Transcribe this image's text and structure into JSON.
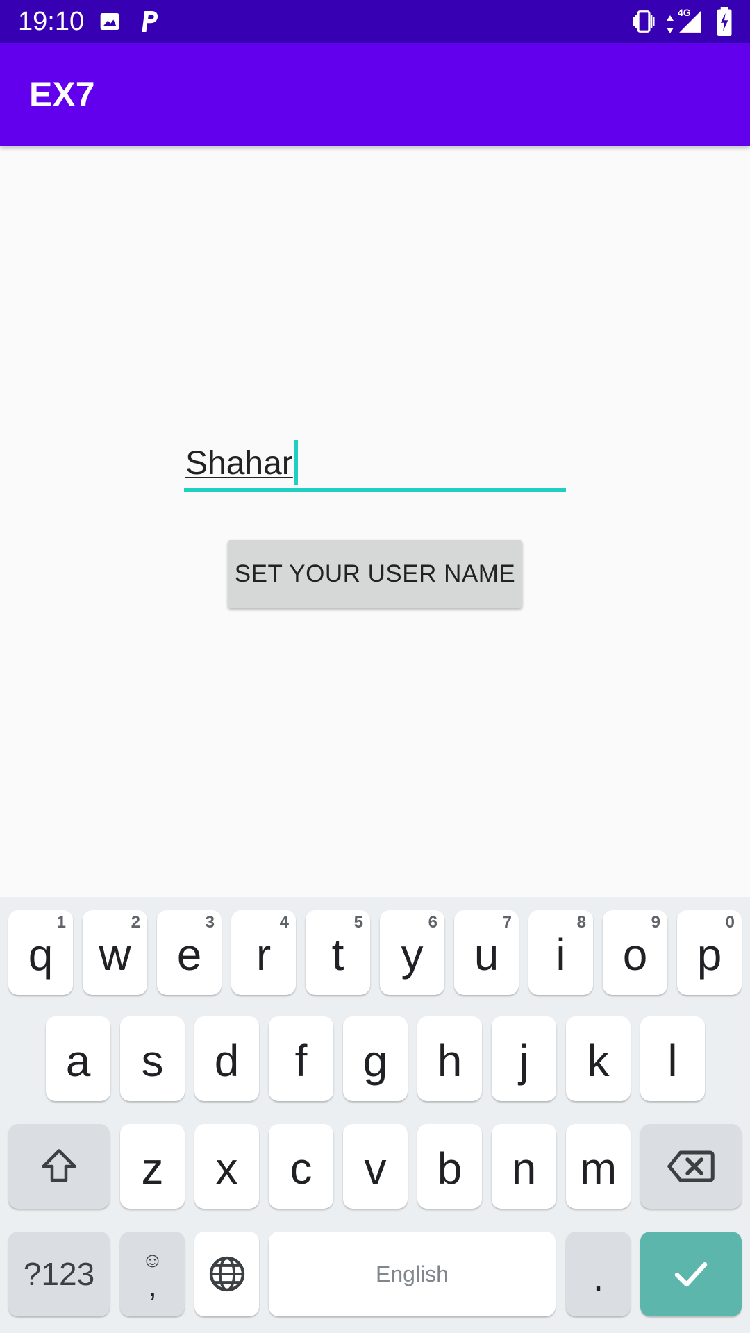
{
  "status_bar": {
    "time": "19:10",
    "icons": [
      "image-icon",
      "parking-icon",
      "vibrate-icon",
      "network-4g-icon",
      "signal-icon",
      "battery-charging-icon"
    ],
    "network_label": "4G"
  },
  "app_bar": {
    "title": "EX7",
    "color": "#6200ee",
    "status_color": "#3700b3"
  },
  "form": {
    "username_value": "Shahar",
    "accent_color": "#1fcfc1",
    "button_label": "SET YOUR USER NAME"
  },
  "keyboard": {
    "row1": [
      {
        "key": "q",
        "hint": "1"
      },
      {
        "key": "w",
        "hint": "2"
      },
      {
        "key": "e",
        "hint": "3"
      },
      {
        "key": "r",
        "hint": "4"
      },
      {
        "key": "t",
        "hint": "5"
      },
      {
        "key": "y",
        "hint": "6"
      },
      {
        "key": "u",
        "hint": "7"
      },
      {
        "key": "i",
        "hint": "8"
      },
      {
        "key": "o",
        "hint": "9"
      },
      {
        "key": "p",
        "hint": "0"
      }
    ],
    "row2": [
      "a",
      "s",
      "d",
      "f",
      "g",
      "h",
      "j",
      "k",
      "l"
    ],
    "row3": [
      "z",
      "x",
      "c",
      "v",
      "b",
      "n",
      "m"
    ],
    "symbols_label": "?123",
    "emoji_top": "☺",
    "comma": ",",
    "space_label": "English",
    "period": ".",
    "enter_color": "#5db6ab"
  }
}
